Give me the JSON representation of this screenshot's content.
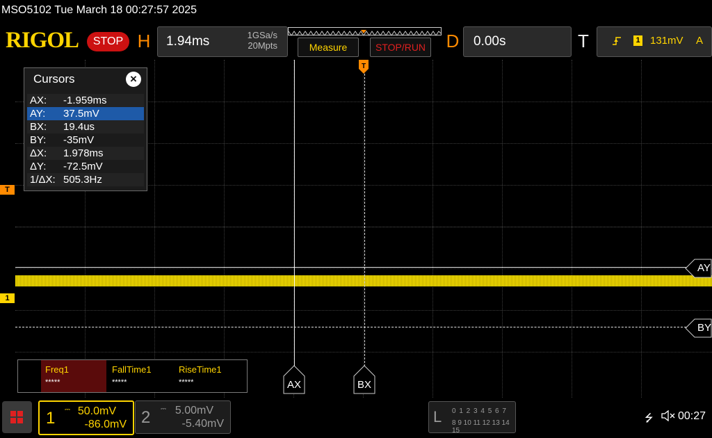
{
  "status": {
    "title": "MSO5102  Tue March 18 00:27:57 2025"
  },
  "toolbar": {
    "logo": "RIGOL",
    "run_state": "STOP",
    "horizontal": {
      "letter": "H",
      "timebase": "1.94ms",
      "sample_rate": "1GSa/s",
      "memory_depth": "20Mpts"
    },
    "measure_label": "Measure",
    "stop_run_label": "STOP/RUN",
    "delay": {
      "letter": "D",
      "value": "0.00s"
    },
    "trigger": {
      "letter": "T",
      "edge_icon": "rising-edge-icon",
      "channel": "1",
      "level": "131mV",
      "mode": "A"
    }
  },
  "cursors": {
    "title": "Cursors",
    "rows": [
      {
        "label": "AX:",
        "value": "-1.959ms"
      },
      {
        "label": "AY:",
        "value": "37.5mV"
      },
      {
        "label": "BX:",
        "value": "19.4us"
      },
      {
        "label": "BY:",
        "value": "-35mV"
      },
      {
        "label": "ΔX:",
        "value": "1.978ms"
      },
      {
        "label": "ΔY:",
        "value": "-72.5mV"
      },
      {
        "label": "1/ΔX:",
        "value": "505.3Hz"
      }
    ],
    "tags": {
      "ax": "AX",
      "bx": "BX",
      "ay": "AY",
      "by": "BY"
    }
  },
  "markers": {
    "trigger": "T",
    "channel1": "1"
  },
  "measurements": [
    {
      "name": "Freq1",
      "value": "*****"
    },
    {
      "name": "FallTime1",
      "value": "*****"
    },
    {
      "name": "RiseTime1",
      "value": "*****"
    }
  ],
  "channels": {
    "ch1": {
      "number": "1",
      "scale": "50.0mV",
      "offset": "-86.0mV"
    },
    "ch2": {
      "number": "2",
      "scale": "5.00mV",
      "offset": "-5.40mV"
    }
  },
  "logic": {
    "letter": "L",
    "row1": "0 1 2 3  4 5 6 7",
    "row2": "8 9 10 11 12 13 14 15"
  },
  "system": {
    "time": "00:27"
  },
  "colors": {
    "ch1": "#ffd400",
    "trigger": "#ff8a00",
    "stop": "#cc1111"
  }
}
